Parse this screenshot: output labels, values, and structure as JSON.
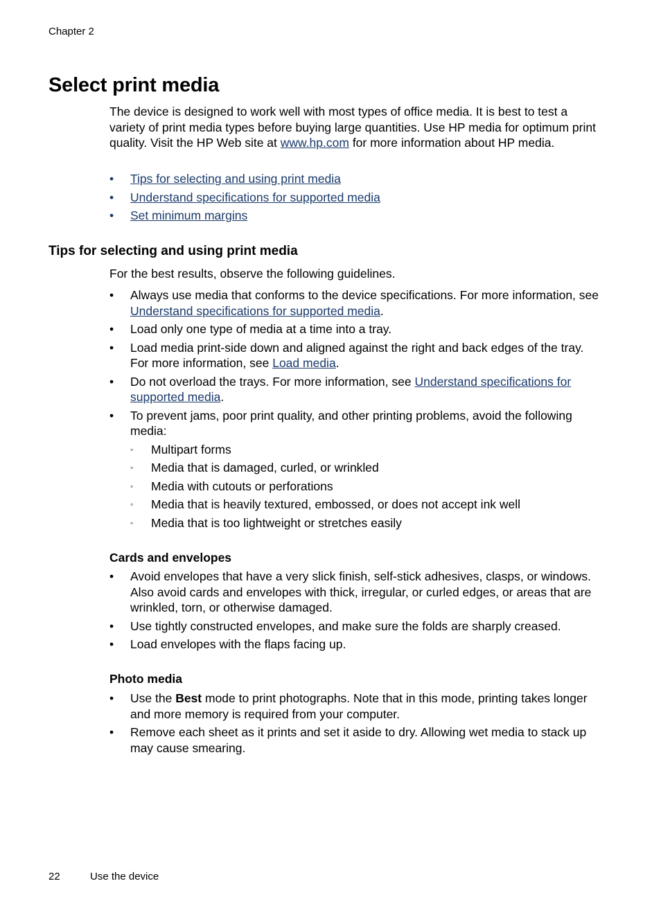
{
  "header": {
    "running_head": "Chapter 2"
  },
  "section": {
    "title": "Select print media",
    "intro_before_link": "The device is designed to work well with most types of office media. It is best to test a variety of print media types before buying large quantities. Use HP media for optimum print quality. Visit the HP Web site at ",
    "intro_link": "www.hp.com",
    "intro_after_link": " for more information about HP media.",
    "links": [
      "Tips for selecting and using print media",
      "Understand specifications for supported media",
      "Set minimum margins"
    ],
    "bullet": "•",
    "sub_bullet": "◦"
  },
  "tips": {
    "title": "Tips for selecting and using print media",
    "intro": "For the best results, observe the following guidelines.",
    "items": [
      {
        "before": "Always use media that conforms to the device specifications. For more information, see ",
        "link": "Understand specifications for supported media",
        "after": "."
      },
      {
        "text": "Load only one type of media at a time into a tray."
      },
      {
        "before": "Load media print-side down and aligned against the right and back edges of the tray. For more information, see ",
        "link": "Load media",
        "after": "."
      },
      {
        "before": "Do not overload the trays. For more information, see ",
        "link": "Understand specifications for supported media",
        "after": "."
      },
      {
        "text": "To prevent jams, poor print quality, and other printing problems, avoid the following media:"
      }
    ],
    "avoid_media": [
      "Multipart forms",
      "Media that is damaged, curled, or wrinkled",
      "Media with cutouts or perforations",
      "Media that is heavily textured, embossed, or does not accept ink well",
      "Media that is too lightweight or stretches easily"
    ]
  },
  "cards": {
    "title": "Cards and envelopes",
    "items": [
      "Avoid envelopes that have a very slick finish, self-stick adhesives, clasps, or windows. Also avoid cards and envelopes with thick, irregular, or curled edges, or areas that are wrinkled, torn, or otherwise damaged.",
      "Use tightly constructed envelopes, and make sure the folds are sharply creased.",
      "Load envelopes with the flaps facing up."
    ]
  },
  "photo": {
    "title": "Photo media",
    "item1_before": "Use the ",
    "item1_bold": "Best",
    "item1_after": " mode to print photographs. Note that in this mode, printing takes longer and more memory is required from your computer.",
    "item2": "Remove each sheet as it prints and set it aside to dry. Allowing wet media to stack up may cause smearing."
  },
  "footer": {
    "page_number": "22",
    "section": "Use the device"
  },
  "colors": {
    "link": "#1a3a6b",
    "text": "#000000"
  }
}
